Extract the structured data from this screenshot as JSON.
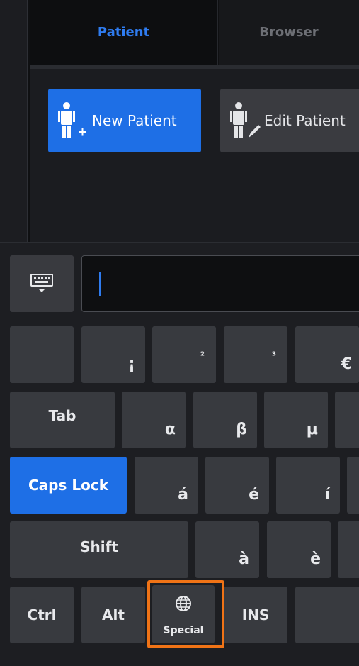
{
  "tabs": {
    "patient": "Patient",
    "browser": "Browser"
  },
  "actions": {
    "new_patient": "New Patient",
    "edit_patient": "Edit Patient"
  },
  "input": {
    "value": ""
  },
  "keyboard": {
    "row1": [
      "",
      "¡",
      "²",
      "³",
      "€"
    ],
    "row2": {
      "tab": "Tab",
      "keys": [
        "α",
        "β",
        "μ"
      ]
    },
    "row3": {
      "caps_lock": "Caps Lock",
      "keys": [
        "á",
        "é",
        "í"
      ]
    },
    "row4": {
      "shift": "Shift",
      "keys": [
        "à",
        "è"
      ]
    },
    "row5": {
      "ctrl": "Ctrl",
      "alt": "Alt",
      "special": "Special",
      "ins": "INS"
    }
  },
  "colors": {
    "accent": "#1e6fe6",
    "highlight": "#f07316",
    "active_tab_text": "#2f7cf0"
  }
}
